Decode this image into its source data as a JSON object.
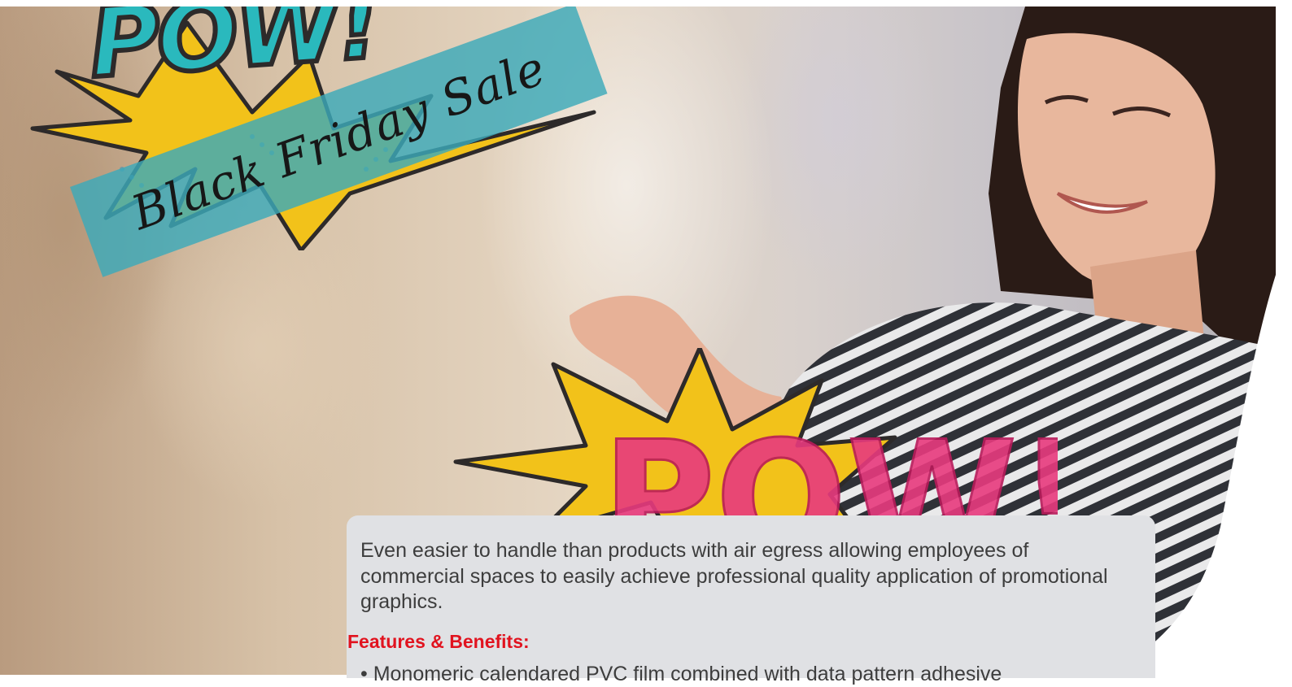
{
  "hero": {
    "pow_word": "POW!",
    "sale_banner": "Black Friday Sale",
    "bottom_word": "POW!",
    "colors": {
      "teal": "#2ab9bd",
      "yellow": "#f2c21a",
      "magenta": "#e83a7e",
      "ribbon": "#3caab9"
    }
  },
  "card": {
    "intro": "Even easier to handle than products with air egress allowing employees of commercial spaces to easily achieve professional quality application of promotional graphics.",
    "heading": "Features & Benefits:",
    "bullet_1": "• Monomeric calendared PVC film combined with data pattern adhesive",
    "heading_color": "#e1131f"
  }
}
